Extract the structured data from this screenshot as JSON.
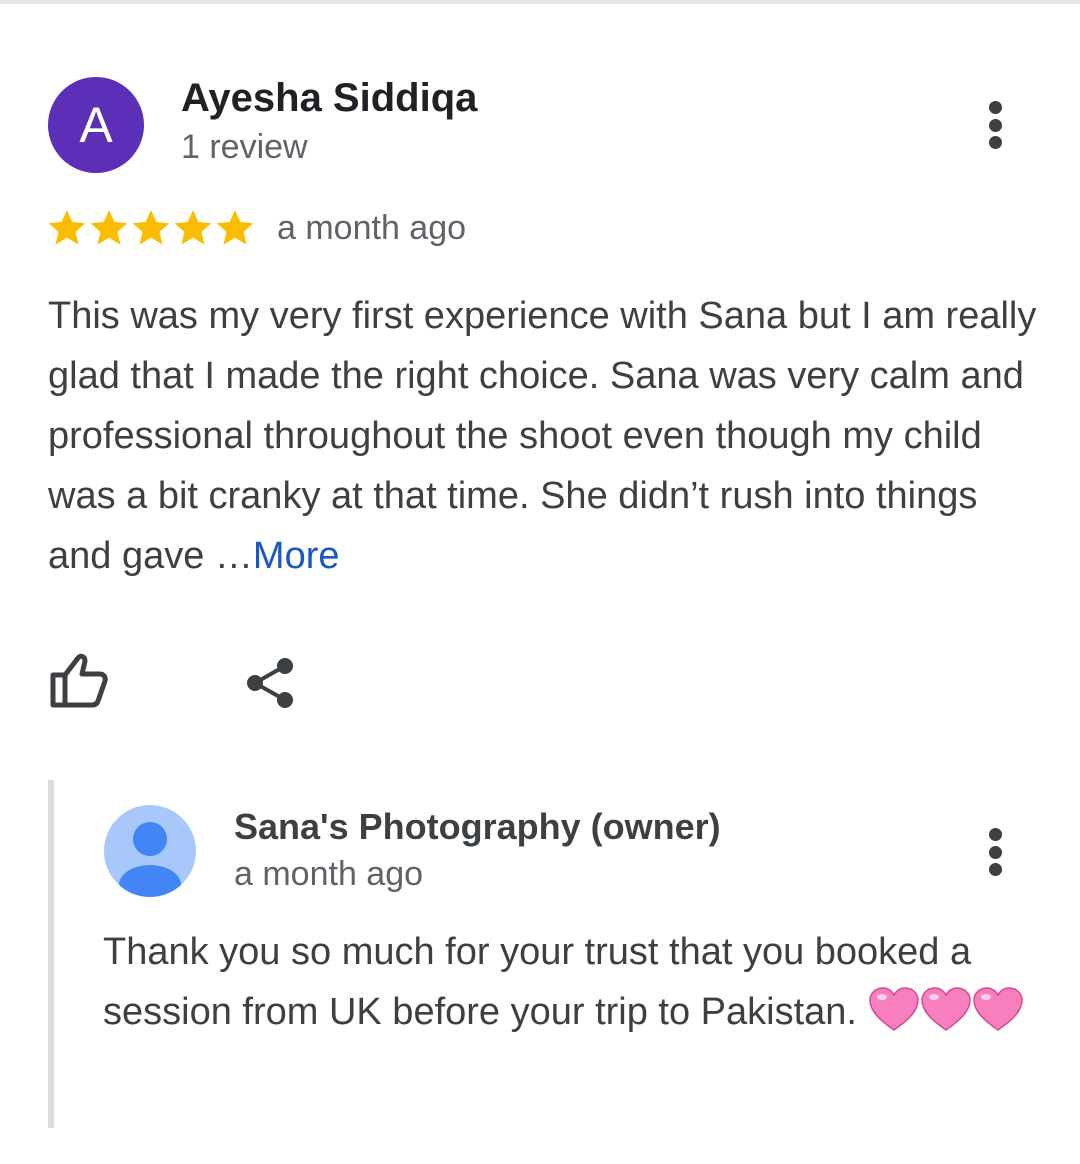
{
  "review": {
    "avatar_letter": "A",
    "avatar_color": "#5b2fb8",
    "reviewer_name": "Ayesha Siddiqa",
    "review_count": "1 review",
    "rating": 5,
    "max_rating": 5,
    "time": "a month ago",
    "text": "This was my very first experience with Sana but I am really glad that I made the right choice. Sana was very calm and professional throughout the shoot even though my child was a bit cranky at that time. She didn’t rush into things and gave …",
    "more_label": "More",
    "more_color": "#1a56c4",
    "star_color": "#fbbc04"
  },
  "actions": {
    "like_icon": "thumbs-up-icon",
    "share_icon": "share-icon"
  },
  "owner_reply": {
    "owner_name": "Sana's Photography (owner)",
    "time": "a month ago",
    "text": "Thank you so much for your trust that you booked a session from UK before your trip to Pakistan.",
    "heart_count": 3
  }
}
